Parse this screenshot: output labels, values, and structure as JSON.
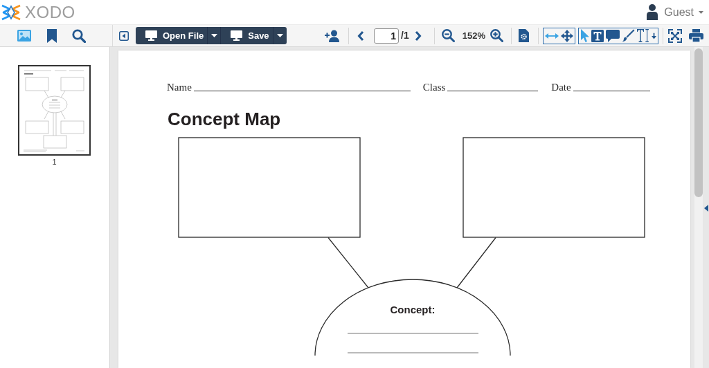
{
  "header": {
    "logo_text": "XODO",
    "user_menu": {
      "label": "Guest"
    }
  },
  "panel_tabs": [
    {
      "kind": "thumbnails",
      "selected": true
    },
    {
      "kind": "bookmarks",
      "selected": false
    },
    {
      "kind": "search",
      "selected": false
    }
  ],
  "file_buttons": [
    {
      "label": "Open File"
    },
    {
      "label": "Save"
    }
  ],
  "pager": {
    "page": "1",
    "total": "/1"
  },
  "zoom_percent": "152%",
  "view_modes": [
    {
      "kind": "fit-width",
      "selected": true
    },
    {
      "kind": "pan",
      "selected": false
    }
  ],
  "tools": [
    {
      "kind": "pointer",
      "selected": true
    },
    {
      "kind": "text-box",
      "selected": false
    },
    {
      "kind": "comment",
      "selected": false
    },
    {
      "kind": "pen",
      "selected": false
    },
    {
      "kind": "text-select",
      "selected": false
    }
  ],
  "thumbnails": [
    {
      "label": "1",
      "selected": true
    }
  ],
  "document": {
    "fields": [
      {
        "label": "Name"
      },
      {
        "label": "Class"
      },
      {
        "label": "Date"
      }
    ],
    "title": "Concept Map",
    "center_label": "Concept:"
  }
}
